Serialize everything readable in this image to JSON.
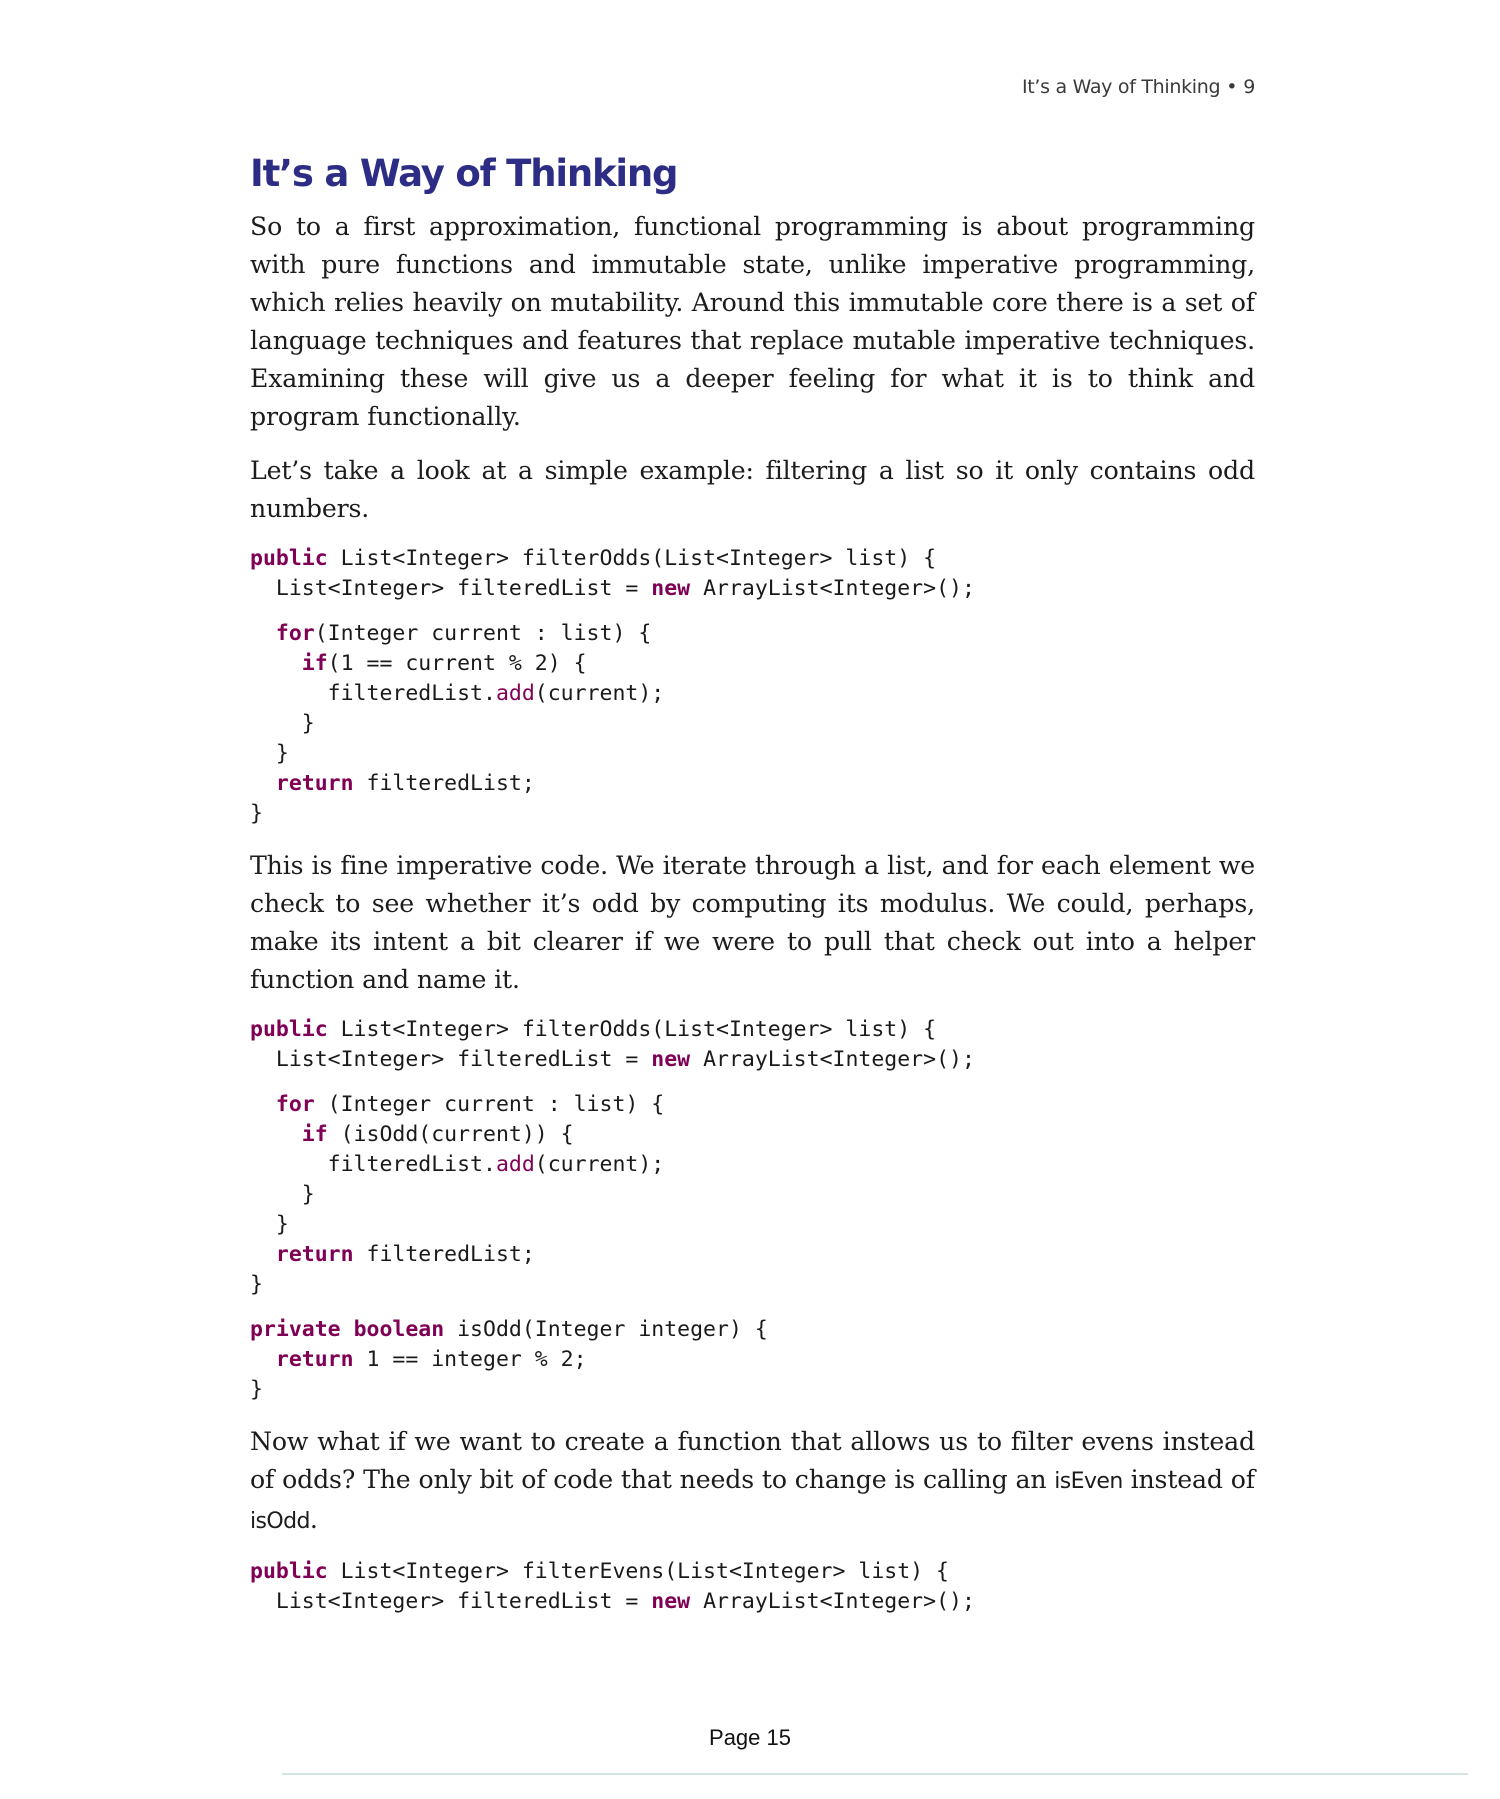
{
  "running_header": {
    "title": "It’s a Way of Thinking",
    "separator": "•",
    "page_number": "9"
  },
  "section": {
    "title": "It’s a Way of Thinking"
  },
  "paragraphs": [
    {
      "text": "So to a first approximation, functional programming is about programming with pure functions and immutable state, unlike imperative programming, which relies heavily on mutability. Around this immutable core there is a set of language techniques and features that replace mutable imperative tech­niques. Examining these will give us a deeper feeling for what it is to think and program functionally."
    },
    {
      "text": "Let’s take a look at a simple example: filtering a list so it only contains odd numbers."
    },
    {
      "text": "This is fine imperative code. We iterate through a list, and for each element we check to see whether it’s odd by computing its modulus. We could, perhaps, make its intent a bit clearer if we were to pull that check out into a helper function and name it."
    },
    {
      "text_before": "Now what if we want to create a function that allows us to filter evens instead of odds? The only bit of code that needs to change is calling an ",
      "code_1": "isEven",
      "text_middle": " instead of ",
      "code_2": "isOdd",
      "text_after": "."
    }
  ],
  "code_blocks": [
    {
      "lines": [
        [
          {
            "k": "public"
          },
          {
            "t": " List<Integer> filterOdds(List<Integer> list) {"
          }
        ],
        [
          {
            "t": "  List<Integer> filteredList = "
          },
          {
            "k": "new"
          },
          {
            "t": " ArrayList<Integer>();"
          }
        ],
        "gap",
        [
          {
            "t": "  "
          },
          {
            "k": "for"
          },
          {
            "t": "(Integer current : list) {"
          }
        ],
        [
          {
            "t": "    "
          },
          {
            "k": "if"
          },
          {
            "t": "(1 == current % 2) {"
          }
        ],
        [
          {
            "t": "      filteredList."
          },
          {
            "m": "add"
          },
          {
            "t": "(current);"
          }
        ],
        [
          {
            "t": "    }"
          }
        ],
        [
          {
            "t": "  }"
          }
        ],
        [
          {
            "t": "  "
          },
          {
            "k": "return"
          },
          {
            "t": " filteredList;"
          }
        ],
        [
          {
            "t": "}"
          }
        ]
      ]
    },
    {
      "lines": [
        [
          {
            "k": "public"
          },
          {
            "t": " List<Integer> filterOdds(List<Integer> list) {"
          }
        ],
        [
          {
            "t": "  List<Integer> filteredList = "
          },
          {
            "k": "new"
          },
          {
            "t": " ArrayList<Integer>();"
          }
        ],
        "gap",
        [
          {
            "t": "  "
          },
          {
            "k": "for"
          },
          {
            "t": " (Integer current : list) {"
          }
        ],
        [
          {
            "t": "    "
          },
          {
            "k": "if"
          },
          {
            "t": " (isOdd(current)) {"
          }
        ],
        [
          {
            "t": "      filteredList."
          },
          {
            "m": "add"
          },
          {
            "t": "(current);"
          }
        ],
        [
          {
            "t": "    }"
          }
        ],
        [
          {
            "t": "  }"
          }
        ],
        [
          {
            "t": "  "
          },
          {
            "k": "return"
          },
          {
            "t": " filteredList;"
          }
        ],
        [
          {
            "t": "}"
          }
        ],
        "gap",
        [
          {
            "k": "private"
          },
          {
            "t": " "
          },
          {
            "k": "boolean"
          },
          {
            "t": " isOdd(Integer integer) {"
          }
        ],
        [
          {
            "t": "  "
          },
          {
            "k": "return"
          },
          {
            "t": " 1 == integer % 2;"
          }
        ],
        [
          {
            "t": "}"
          }
        ]
      ]
    },
    {
      "lines": [
        [
          {
            "k": "public"
          },
          {
            "t": " List<Integer> filterEvens(List<Integer> list) {"
          }
        ],
        [
          {
            "t": "  List<Integer> filteredList = "
          },
          {
            "k": "new"
          },
          {
            "t": " ArrayList<Integer>();"
          }
        ]
      ]
    }
  ],
  "footer": {
    "page_label": "Page 15"
  },
  "colors": {
    "title": "#2e2d85",
    "keyword": "#7f0055",
    "footer_rule": "#d5e3e3"
  }
}
